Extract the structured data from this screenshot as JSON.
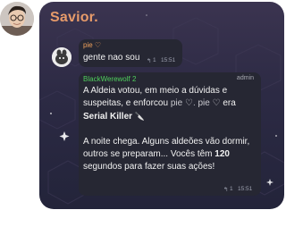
{
  "chat": {
    "title": "Savior."
  },
  "messages": [
    {
      "sender": "pie ♡",
      "text": "gente nao sou",
      "reply_count": "1",
      "time": "15:51"
    },
    {
      "sender": "BlackWerewolf 2",
      "role": "admin",
      "p1_a": "A Aldeia votou, em meio a dúvidas e suspeitas, e enforcou ",
      "p1_name1": "pie ♡",
      "p1_sep": ". ",
      "p1_name2": "pie ♡",
      "p1_b": " era ",
      "p1_role": "Serial Killer",
      "p1_icon": "🔪",
      "p2_a": "A noite chega. Alguns aldeões vão dormir, outros se preparam... Vocês têm ",
      "p2_num": "120",
      "p2_b": " segundos para fazer suas ações!",
      "reply_count": "1",
      "time": "15:51"
    }
  ],
  "colors": {
    "title": "#e79b6a",
    "bubble": "#262733",
    "pie_name": "#f0a25c",
    "bot_name": "#4fcf5c"
  },
  "icons": [
    "reply-arrow-icon",
    "sparkle-icon",
    "knife-icon"
  ]
}
